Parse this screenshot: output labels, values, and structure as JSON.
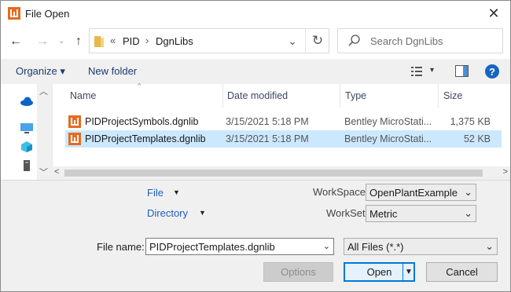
{
  "window": {
    "title": "File Open"
  },
  "nav": {
    "back_glyph": "←",
    "forward_glyph": "→",
    "recent_glyph": "⌄",
    "up_glyph": "↑",
    "breadcrumb_prefix": "«",
    "breadcrumb": [
      "PID",
      "DgnLibs"
    ],
    "breadcrumb_sep": "›",
    "dropdown_glyph": "⌄",
    "refresh_glyph": "↻"
  },
  "search": {
    "placeholder": "Search DgnLibs"
  },
  "toolbar": {
    "organize_label": "Organize",
    "organize_arrow": "▾",
    "new_folder_label": "New folder",
    "view_arrow": "▾",
    "help_glyph": "?"
  },
  "columns": {
    "name": "Name",
    "date_modified": "Date modified",
    "type": "Type",
    "size": "Size",
    "sort_indicator": "^"
  },
  "files": [
    {
      "name": "PIDProjectSymbols.dgnlib",
      "date_modified": "3/15/2021 5:18 PM",
      "type": "Bentley MicroStati...",
      "size": "1,375 KB",
      "selected": false
    },
    {
      "name": "PIDProjectTemplates.dgnlib",
      "date_modified": "3/15/2021 5:18 PM",
      "type": "Bentley MicroStati...",
      "size": "52 KB",
      "selected": true
    }
  ],
  "scroll": {
    "up": "︿",
    "down": "﹀",
    "left": "<",
    "right": ">"
  },
  "options": {
    "file_link": "File",
    "directory_link": "Directory",
    "menu_arrow": "▼",
    "workspace_label": "WorkSpace",
    "workspace_value": "OpenPlantExample",
    "workset_label": "WorkSet",
    "workset_value": "Metric",
    "combo_arrow": "⌄"
  },
  "file_name": {
    "label": "File name:",
    "value": "PIDProjectTemplates.dgnlib",
    "filter_value": "All Files (*.*)"
  },
  "buttons": {
    "options": "Options",
    "open": "Open",
    "open_arrow": "▼",
    "cancel": "Cancel"
  },
  "colors": {
    "accent": "#0078d7",
    "link": "#1e5fbf",
    "selection": "#cce8ff",
    "file_icon": "#e56b1f"
  }
}
